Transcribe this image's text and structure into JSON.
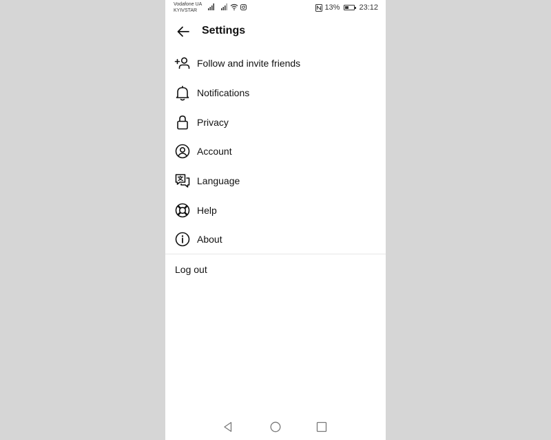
{
  "status_bar": {
    "carrier_1": "Vodafone UA",
    "carrier_2": "KYIVSTAR",
    "battery_percent": "13%",
    "battery_level": 0.13,
    "time": "23:12"
  },
  "header": {
    "title": "Settings"
  },
  "menu": {
    "items": [
      {
        "label": "Follow and invite friends",
        "icon": "add-person-icon"
      },
      {
        "label": "Notifications",
        "icon": "bell-icon"
      },
      {
        "label": "Privacy",
        "icon": "lock-icon"
      },
      {
        "label": "Account",
        "icon": "account-circle-icon"
      },
      {
        "label": "Language",
        "icon": "translate-icon"
      },
      {
        "label": "Help",
        "icon": "lifebuoy-icon"
      },
      {
        "label": "About",
        "icon": "info-icon"
      }
    ]
  },
  "logout": {
    "label": "Log out"
  },
  "colors": {
    "background": "#d6d6d6",
    "surface": "#ffffff",
    "text": "#111111",
    "divider": "#e6e6e6"
  }
}
